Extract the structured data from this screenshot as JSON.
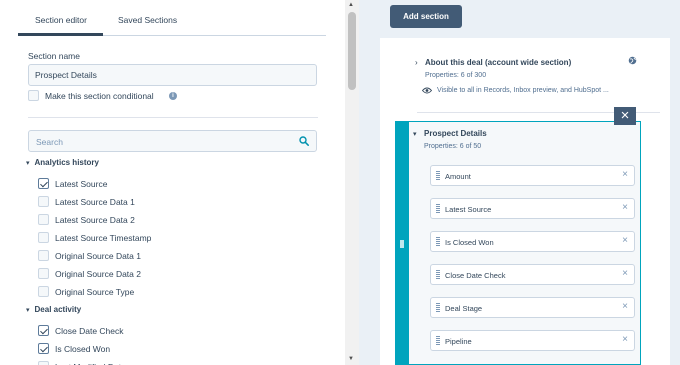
{
  "tabs": {
    "editor": "Section editor",
    "saved": "Saved Sections"
  },
  "section_name": {
    "label": "Section name",
    "value": "Prospect Details"
  },
  "conditional": {
    "label": "Make this section conditional",
    "checked": false
  },
  "search": {
    "placeholder": "Search"
  },
  "groups": [
    {
      "name": "Analytics history",
      "items": [
        {
          "label": "Latest Source",
          "checked": true
        },
        {
          "label": "Latest Source Data 1",
          "checked": false
        },
        {
          "label": "Latest Source Data 2",
          "checked": false
        },
        {
          "label": "Latest Source Timestamp",
          "checked": false
        },
        {
          "label": "Original Source Data 1",
          "checked": false
        },
        {
          "label": "Original Source Data 2",
          "checked": false
        },
        {
          "label": "Original Source Type",
          "checked": false
        }
      ]
    },
    {
      "name": "Deal activity",
      "items": [
        {
          "label": "Close Date Check",
          "checked": true
        },
        {
          "label": "Is Closed Won",
          "checked": true
        },
        {
          "label": "Last Modified Date",
          "checked": false
        }
      ]
    }
  ],
  "right": {
    "add_section": "Add section",
    "deal_section": {
      "title": "About this deal (account wide section)",
      "props": "Properties: 6 of 300",
      "visibility": "Visible to all in Records, Inbox preview, and HubSpot ..."
    },
    "prospect_section": {
      "title": "Prospect Details",
      "props": "Properties: 6 of 50",
      "close": "×",
      "pills": [
        "Amount",
        "Latest Source",
        "Is Closed Won",
        "Close Date Check",
        "Deal Stage",
        "Pipeline"
      ]
    }
  },
  "icons": {
    "search": "search-icon",
    "info": "info-icon",
    "globe": "globe-icon",
    "eye": "eye-icon",
    "close": "close-icon",
    "remove": "remove-x-icon",
    "drag": "drag-handle-icon"
  },
  "colors": {
    "accent": "#00a4bd",
    "button": "#425b76",
    "text": "#33475b",
    "panel_bg": "#eaf0f6"
  }
}
